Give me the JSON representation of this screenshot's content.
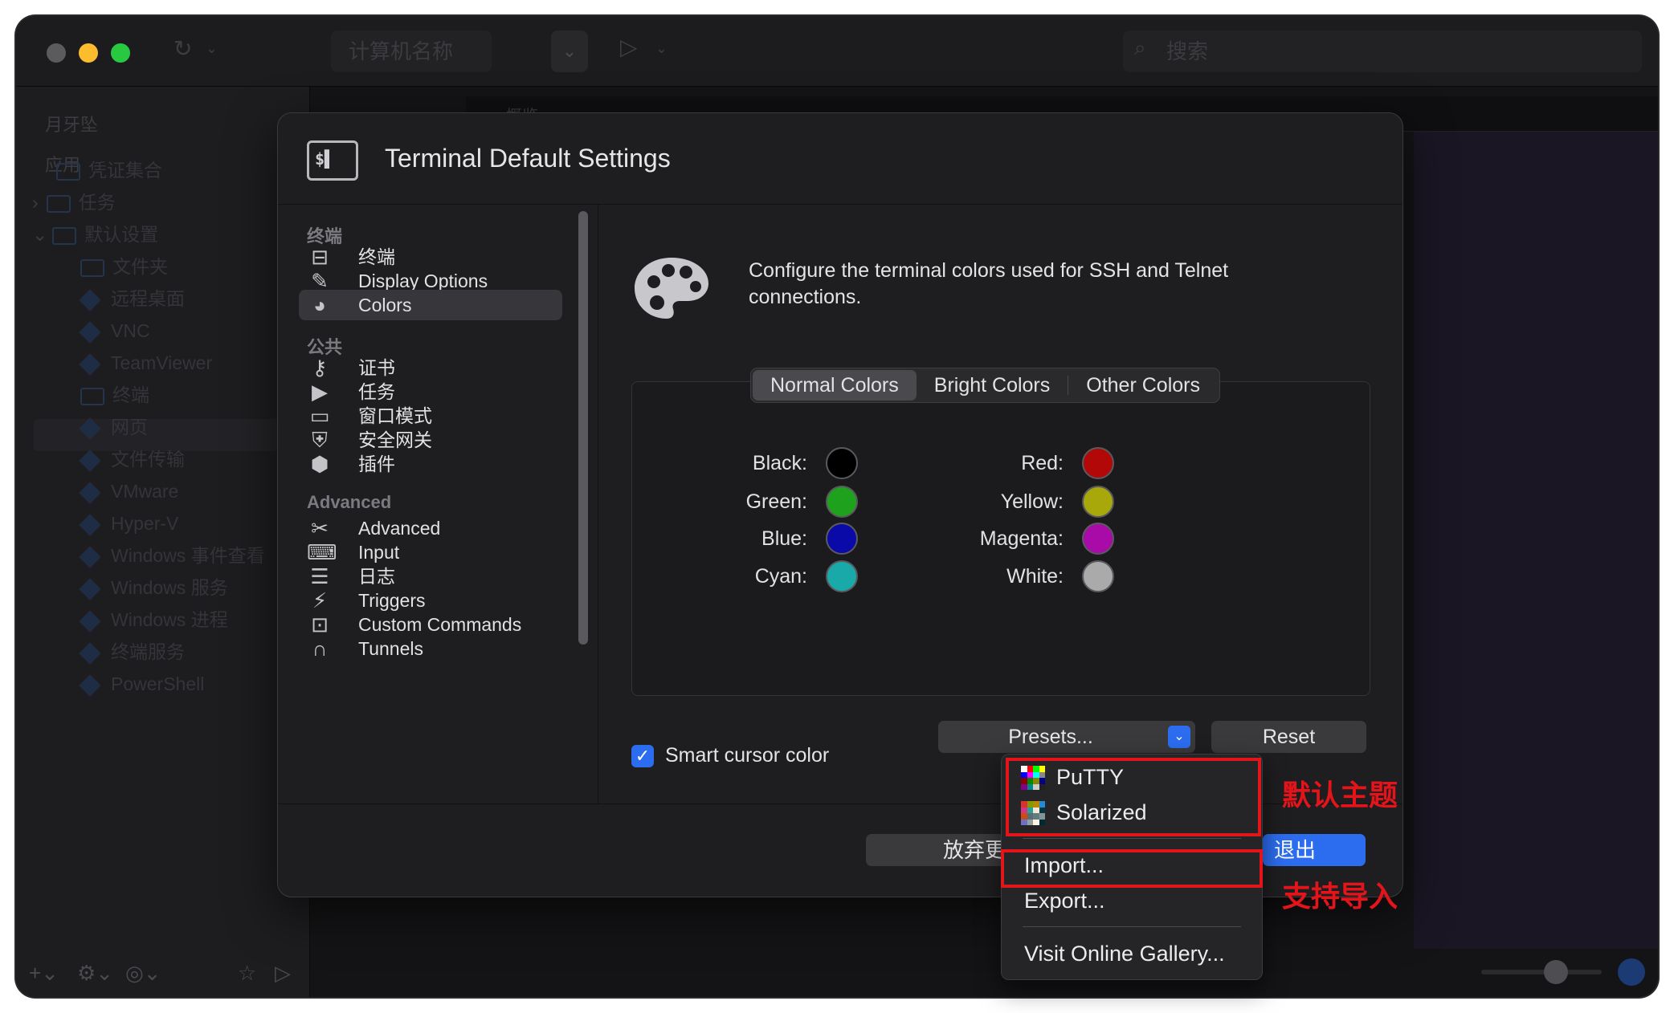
{
  "app": {
    "toolbar": {
      "computer_name_placeholder": "计算机名称",
      "search_placeholder": "搜索"
    },
    "sidebar": {
      "account": "月牙坠",
      "section_apps": "应用",
      "items": [
        "凭证集合",
        "任务",
        "默认设置",
        "文件夹",
        "远程桌面",
        "VNC",
        "TeamViewer",
        "终端",
        "网页",
        "文件传输",
        "VMware",
        "Hyper-V",
        "Windows 事件查看",
        "Windows 服务",
        "Windows 进程",
        "终端服务",
        "PowerShell"
      ]
    },
    "tab_strip_label": "概览"
  },
  "dialog": {
    "title": "Terminal Default Settings",
    "nav": {
      "section_terminal": "终端",
      "section_common": "公共",
      "section_advanced": "Advanced",
      "terminal_items": [
        "终端",
        "Display Options",
        "Colors"
      ],
      "common_items": [
        "证书",
        "任务",
        "窗口模式",
        "安全网关",
        "插件"
      ],
      "advanced_items": [
        "Advanced",
        "Input",
        "日志",
        "Triggers",
        "Custom Commands",
        "Tunnels"
      ],
      "selected": "Colors"
    },
    "description": "Configure the terminal colors used for SSH and Telnet connections.",
    "tabs": [
      "Normal Colors",
      "Bright Colors",
      "Other Colors"
    ],
    "active_tab": "Normal Colors",
    "colors": {
      "left": [
        {
          "label": "Black:",
          "color": "#000000"
        },
        {
          "label": "Green:",
          "color": "#1ea21e"
        },
        {
          "label": "Blue:",
          "color": "#0a0aa8"
        },
        {
          "label": "Cyan:",
          "color": "#1aa9a9"
        }
      ],
      "right": [
        {
          "label": "Red:",
          "color": "#b20808"
        },
        {
          "label": "Yellow:",
          "color": "#a9a80b"
        },
        {
          "label": "Magenta:",
          "color": "#a80ba8"
        },
        {
          "label": "White:",
          "color": "#aaaaaa"
        }
      ]
    },
    "smart_cursor_label": "Smart cursor color",
    "smart_cursor_checked": true,
    "presets_label": "Presets...",
    "reset_label": "Reset",
    "discard_label": "放弃更",
    "exit_label": "退出"
  },
  "presets_menu": {
    "items": [
      "PuTTY",
      "Solarized"
    ],
    "actions": [
      "Import...",
      "Export..."
    ],
    "gallery": "Visit Online Gallery..."
  },
  "annotations": {
    "default_themes": "默认主题",
    "import_support": "支持导入"
  }
}
